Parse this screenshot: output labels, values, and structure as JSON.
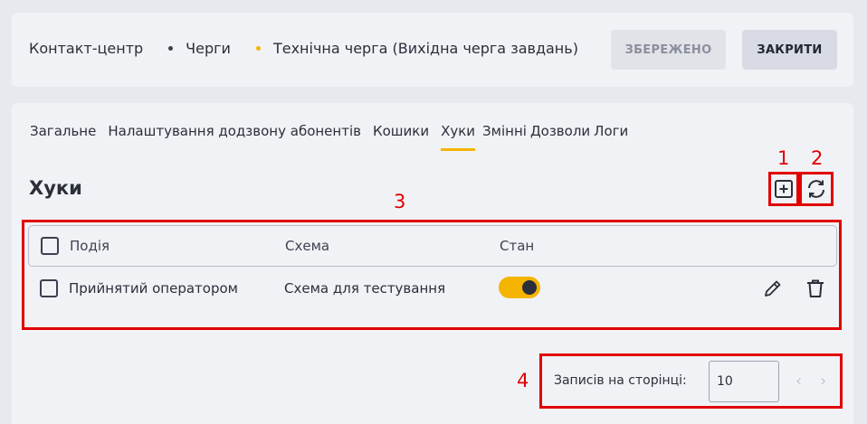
{
  "breadcrumb": {
    "items": [
      "Контакт-центр",
      "Черги",
      "Технічна черга (Вихідна черга завдань)"
    ],
    "dot_colors": [
      "#3a4050",
      "#f5b400"
    ]
  },
  "header": {
    "saved_label": "ЗБЕРЕЖЕНО",
    "close_label": "ЗАКРИТИ"
  },
  "tabs": [
    {
      "label": "Загальне",
      "active": false
    },
    {
      "label": "Налаштування додзвону абонентів",
      "active": false
    },
    {
      "label": "Кошики",
      "active": false
    },
    {
      "label": "Хуки",
      "active": true
    },
    {
      "label": "Змінні",
      "active": false
    },
    {
      "label": "Дозволи",
      "active": false
    },
    {
      "label": "Логи",
      "active": false
    }
  ],
  "section": {
    "title": "Хуки",
    "add_icon": "plus-square-icon",
    "refresh_icon": "refresh-icon"
  },
  "table": {
    "columns": [
      "Подія",
      "Схема",
      "Стан"
    ],
    "rows": [
      {
        "event": "Прийнятий оператором",
        "scheme": "Схема для тестування",
        "enabled": true
      }
    ]
  },
  "pagination": {
    "label": "Записів на сторінці:",
    "per_page": "10"
  },
  "annotations": [
    "1",
    "2",
    "3",
    "4"
  ],
  "colors": {
    "accent": "#f5b400",
    "annotation": "#e00000",
    "background": "#e7e9ee",
    "card": "#f1f2f6"
  }
}
